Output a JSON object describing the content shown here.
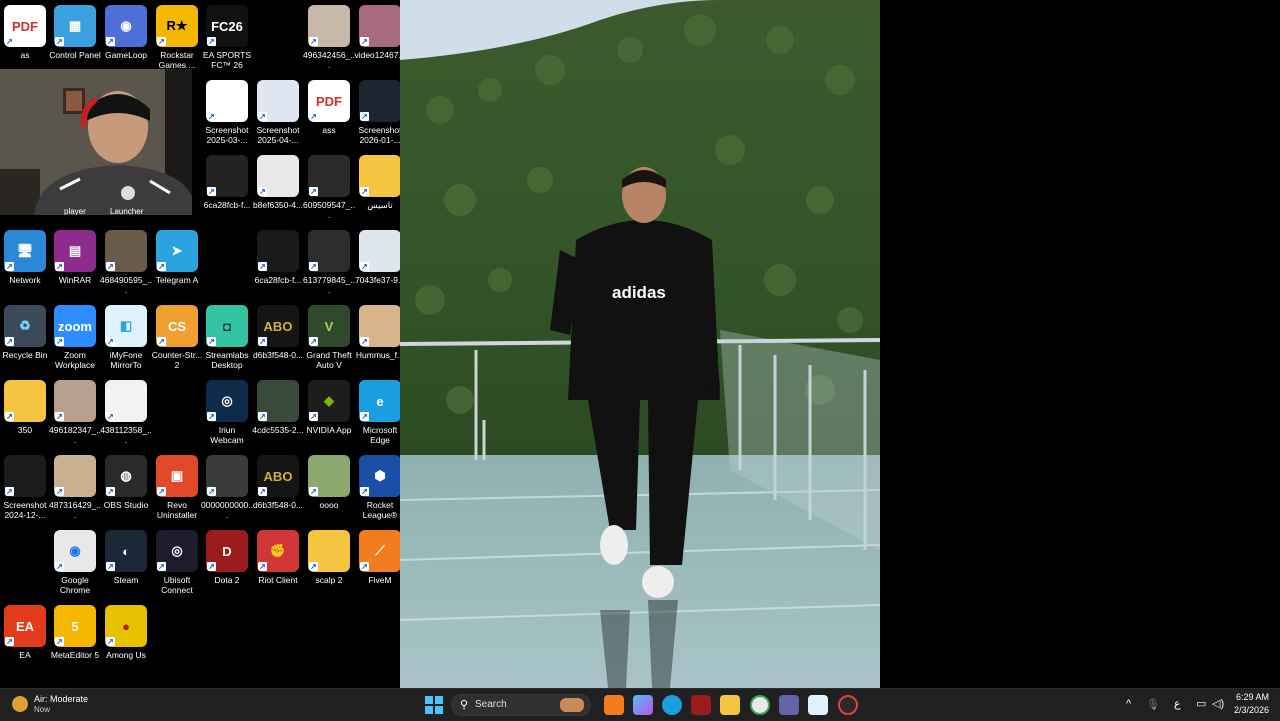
{
  "desktop_icons": [
    {
      "label": "as",
      "color": "#ffffff",
      "glyph": "PDF",
      "fg": "#d32f2f"
    },
    {
      "label": "Control Panel",
      "color": "#3aa0e0",
      "glyph": "▦",
      "fg": "#fff"
    },
    {
      "label": "GameLoop",
      "color": "#4f6fd8",
      "glyph": "◉",
      "fg": "#fff"
    },
    {
      "label": "Rockstar Games ...",
      "color": "#f5b800",
      "glyph": "R★",
      "fg": "#000"
    },
    {
      "label": "EA SPORTS FC™ 26",
      "color": "#111111",
      "glyph": "FC26",
      "fg": "#fff"
    },
    {
      "label": "496342456_...",
      "color": "#c8b8a8",
      "glyph": "",
      "fg": "#fff"
    },
    {
      "label": "video12467...",
      "color": "#a86a80",
      "glyph": "",
      "fg": "#fff"
    },
    {
      "label": "Screenshot 2025-03-...",
      "color": "#ffffff",
      "glyph": "",
      "fg": "#000"
    },
    {
      "label": "Screenshot 2025-04-...",
      "color": "#dfe6f2",
      "glyph": "",
      "fg": "#000"
    },
    {
      "label": "ass",
      "color": "#ffffff",
      "glyph": "PDF",
      "fg": "#d32f2f"
    },
    {
      "label": "Screenshot 2026-01-...",
      "color": "#1e2530",
      "glyph": "",
      "fg": "#fff"
    },
    {
      "label": "6ca28fcb-f...",
      "color": "#222222",
      "glyph": "",
      "fg": "#fff"
    },
    {
      "label": "b8ef6350-4...",
      "color": "#e8e8e8",
      "glyph": "",
      "fg": "#000"
    },
    {
      "label": "609509547_...",
      "color": "#2a2a2a",
      "glyph": "",
      "fg": "#fff"
    },
    {
      "label": "تاسيس",
      "color": "#f5c542",
      "glyph": "",
      "fg": "#fff"
    },
    {
      "label": "Network",
      "color": "#2b88d8",
      "glyph": "🖥",
      "fg": "#fff"
    },
    {
      "label": "WinRAR",
      "color": "#8e2c8e",
      "glyph": "▤",
      "fg": "#fff"
    },
    {
      "label": "468490595_...",
      "color": "#6a5a4a",
      "glyph": "",
      "fg": "#fff"
    },
    {
      "label": "Telegram A",
      "color": "#2aa3df",
      "glyph": "➤",
      "fg": "#fff"
    },
    {
      "label": "6ca28fcb-f...",
      "color": "#1a1a1a",
      "glyph": "",
      "fg": "#fff"
    },
    {
      "label": "613779845_...",
      "color": "#2d2d2d",
      "glyph": "",
      "fg": "#fff"
    },
    {
      "label": "7043fe37-9...",
      "color": "#e0e6ee",
      "glyph": "",
      "fg": "#000"
    },
    {
      "label": "Recycle Bin",
      "color": "#3b4a5a",
      "glyph": "♻",
      "fg": "#7fd3ff"
    },
    {
      "label": "Zoom Workplace",
      "color": "#2d8cff",
      "glyph": "zoom",
      "fg": "#fff"
    },
    {
      "label": "iMyFone MirrorTo",
      "color": "#dff3ff",
      "glyph": "◧",
      "fg": "#2aa3df"
    },
    {
      "label": "Counter-Str... 2",
      "color": "#f0a030",
      "glyph": "CS",
      "fg": "#fff"
    },
    {
      "label": "Streamlabs Desktop",
      "color": "#31c3a2",
      "glyph": "◘",
      "fg": "#102a24"
    },
    {
      "label": "d6b3f548-0...",
      "color": "#151515",
      "glyph": "ABO",
      "fg": "#d4af37"
    },
    {
      "label": "Grand Theft Auto V",
      "color": "#2e4a2a",
      "glyph": "V",
      "fg": "#9fd36a"
    },
    {
      "label": "Hummus_f...",
      "color": "#d8b48a",
      "glyph": "",
      "fg": "#fff"
    },
    {
      "label": "350",
      "color": "#f5c542",
      "glyph": "",
      "fg": "#fff"
    },
    {
      "label": "496182347_...",
      "color": "#b8a090",
      "glyph": "",
      "fg": "#fff"
    },
    {
      "label": "438112358_...",
      "color": "#f2f2f2",
      "glyph": "",
      "fg": "#000"
    },
    {
      "label": "Iriun Webcam",
      "color": "#0f2b4a",
      "glyph": "◎",
      "fg": "#fff"
    },
    {
      "label": "4cdc5535-2...",
      "color": "#3a4a3a",
      "glyph": "",
      "fg": "#fff"
    },
    {
      "label": "NVIDIA App",
      "color": "#1d1d1d",
      "glyph": "◆",
      "fg": "#76b900"
    },
    {
      "label": "Microsoft Edge",
      "color": "#1b9de2",
      "glyph": "e",
      "fg": "#fff"
    },
    {
      "label": "Screenshot 2024-12-...",
      "color": "#1c1c1c",
      "glyph": "",
      "fg": "#fff"
    },
    {
      "label": "487316429_...",
      "color": "#c8b090",
      "glyph": "",
      "fg": "#fff"
    },
    {
      "label": "OBS Studio",
      "color": "#2a2a2a",
      "glyph": "◍",
      "fg": "#fff"
    },
    {
      "label": "Revo Uninstaller",
      "color": "#e04a2a",
      "glyph": "▣",
      "fg": "#fff"
    },
    {
      "label": "0000000000...",
      "color": "#3a3a3a",
      "glyph": "",
      "fg": "#fff"
    },
    {
      "label": "d6b3f548-0...",
      "color": "#151515",
      "glyph": "ABO",
      "fg": "#d4af37"
    },
    {
      "label": "oooo",
      "color": "#8aa870",
      "glyph": "",
      "fg": "#fff"
    },
    {
      "label": "Rocket League®",
      "color": "#1a4fa8",
      "glyph": "⬢",
      "fg": "#fff"
    },
    {
      "label": "Google Chrome",
      "color": "#e8e8e8",
      "glyph": "◉",
      "fg": "#1a73e8"
    },
    {
      "label": "Steam",
      "color": "#1b2838",
      "glyph": "◐",
      "fg": "#fff"
    },
    {
      "label": "Ubisoft Connect",
      "color": "#1c1c2c",
      "glyph": "◎",
      "fg": "#fff"
    },
    {
      "label": "Dota 2",
      "color": "#9a1c1c",
      "glyph": "D",
      "fg": "#fff"
    },
    {
      "label": "Riot Client",
      "color": "#d13639",
      "glyph": "✊",
      "fg": "#fff"
    },
    {
      "label": "scalp 2",
      "color": "#f5c542",
      "glyph": "",
      "fg": "#fff"
    },
    {
      "label": "FiveM",
      "color": "#f47c20",
      "glyph": "⟋",
      "fg": "#fff"
    },
    {
      "label": "EA",
      "color": "#e23b1c",
      "glyph": "EA",
      "fg": "#fff"
    },
    {
      "label": "MetaEditor 5",
      "color": "#f5b800",
      "glyph": "5",
      "fg": "#fff"
    },
    {
      "label": "Among Us",
      "color": "#e5c100",
      "glyph": "●",
      "fg": "#c01818"
    }
  ],
  "webcam": {
    "label_left": "player",
    "label_right": "Launcher"
  },
  "taskbar": {
    "weather_title": "Air: Moderate",
    "weather_sub": "Now",
    "search_placeholder": "Search",
    "lang": "ع",
    "time": "6:29 AM",
    "date": "2/3/2026"
  }
}
